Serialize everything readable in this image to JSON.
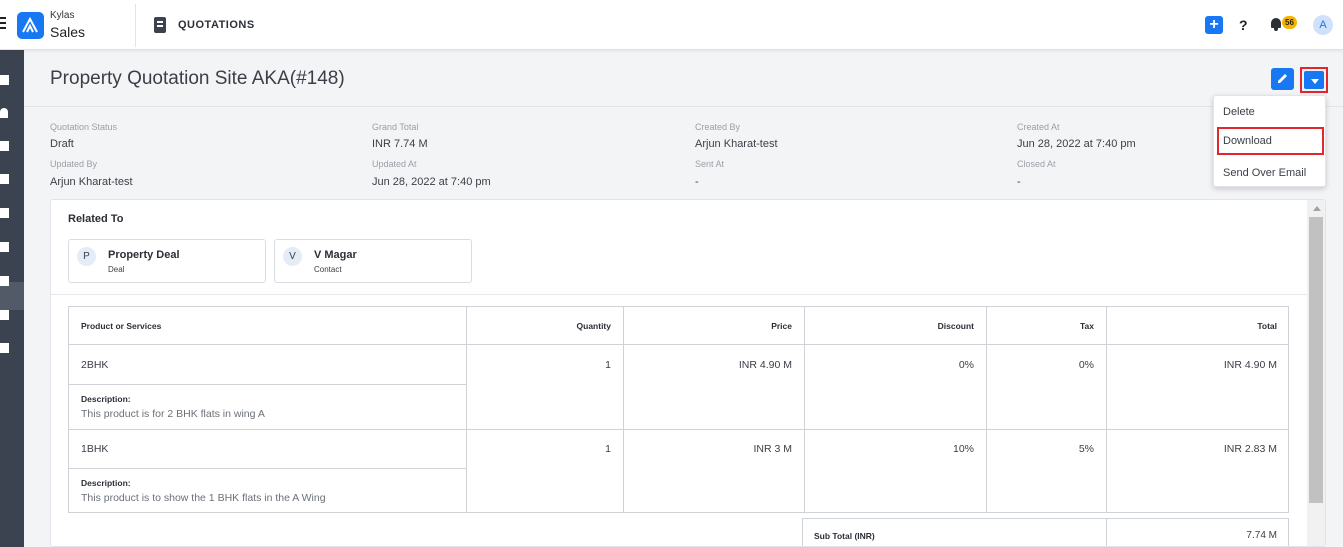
{
  "app": {
    "brand_small": "Kylas",
    "brand_big": "Sales",
    "module": "QUOTATIONS",
    "notification_count": "56",
    "avatar_initial": "A",
    "help_label": "?",
    "add_label": "+"
  },
  "page": {
    "title": "Property Quotation Site AKA(#148)"
  },
  "meta": [
    {
      "label": "Quotation Status",
      "value": "Draft"
    },
    {
      "label": "Grand Total",
      "value": "INR 7.74 M"
    },
    {
      "label": "Created By",
      "value": "Arjun Kharat-test"
    },
    {
      "label": "Created At",
      "value": "Jun 28, 2022 at 7:40 pm"
    },
    {
      "label": "Updated By",
      "value": "Arjun Kharat-test"
    },
    {
      "label": "Updated At",
      "value": "Jun 28, 2022 at 7:40 pm"
    },
    {
      "label": "Sent At",
      "value": "-"
    },
    {
      "label": "Closed At",
      "value": "-"
    }
  ],
  "related": {
    "heading": "Related To",
    "items": [
      {
        "initial": "P",
        "name": "Property Deal",
        "type": "Deal"
      },
      {
        "initial": "V",
        "name": "V Magar",
        "type": "Contact"
      }
    ]
  },
  "table": {
    "headers": [
      "Product or Services",
      "Quantity",
      "Price",
      "Discount",
      "Tax",
      "Total"
    ],
    "description_label": "Description:",
    "rows": [
      {
        "product": "2BHK",
        "quantity": "1",
        "price": "INR 4.90 M",
        "discount": "0%",
        "tax": "0%",
        "total": "INR 4.90 M",
        "description": "This product is for 2 BHK flats in wing A"
      },
      {
        "product": "1BHK",
        "quantity": "1",
        "price": "INR 3 M",
        "discount": "10%",
        "tax": "5%",
        "total": "INR 2.83 M",
        "description": "This product is to show the 1 BHK flats in the A Wing"
      }
    ]
  },
  "summary": {
    "subtotal_label": "Sub Total (INR)",
    "subtotal_value": "7.74 M"
  },
  "menu": {
    "items": [
      "Delete",
      "Download",
      "Send Over Email"
    ]
  },
  "colors": {
    "accent": "#1877f2",
    "highlight": "#e1262e",
    "sidebar": "#3c4350",
    "badge": "#f5b400"
  }
}
